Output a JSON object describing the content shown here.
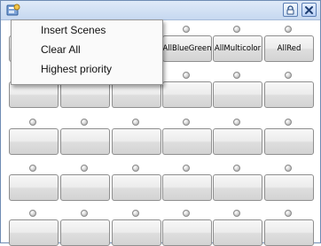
{
  "window": {
    "title_icon": "app-icon",
    "lock_icon": "lock-icon",
    "close_icon": "close-icon",
    "accent": "#c6d8f0"
  },
  "context_menu": {
    "items": [
      {
        "label": "Insert Scenes"
      },
      {
        "label": "Clear All"
      },
      {
        "label": "Highest priority"
      }
    ]
  },
  "scenes": {
    "rows": [
      {
        "labels": [
          "",
          "",
          "",
          "AllBlueGreen",
          "AllMulticolor",
          "AllRed"
        ]
      },
      {
        "labels": [
          "",
          "",
          "",
          "",
          "",
          ""
        ]
      },
      {
        "labels": [
          "",
          "",
          "",
          "",
          "",
          ""
        ]
      },
      {
        "labels": [
          "",
          "",
          "",
          "",
          "",
          ""
        ]
      },
      {
        "labels": [
          "",
          "",
          "",
          "",
          "",
          ""
        ]
      }
    ]
  }
}
